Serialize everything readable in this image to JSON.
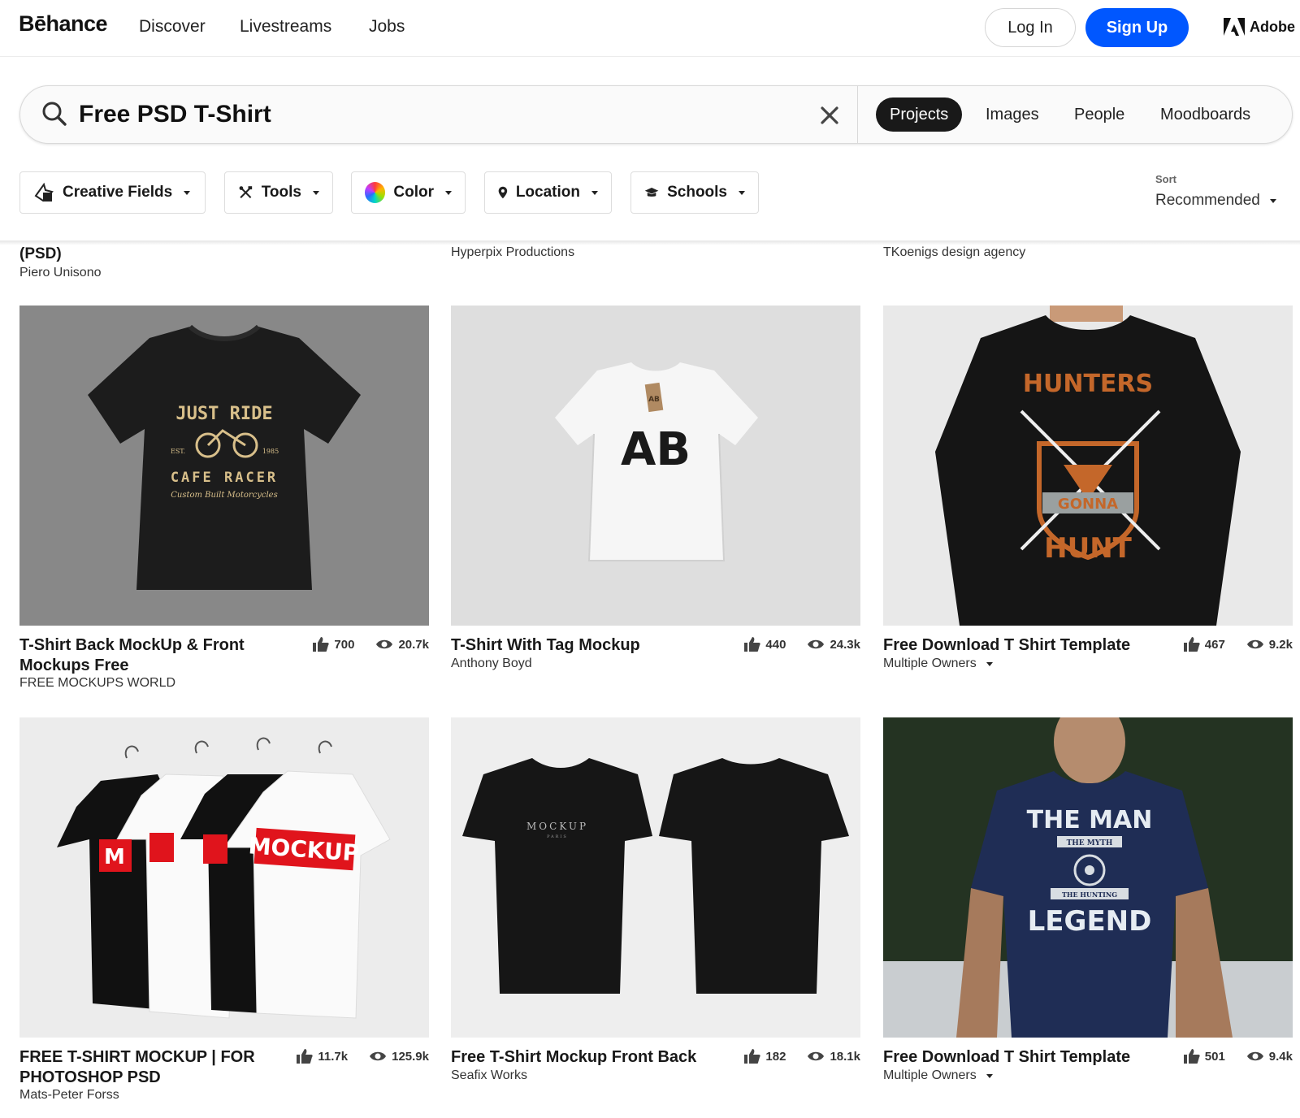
{
  "nav": {
    "logo": "Bēhance",
    "links": [
      "Discover",
      "Livestreams",
      "Jobs"
    ],
    "login": "Log In",
    "signup": "Sign Up",
    "adobe": "Adobe"
  },
  "search": {
    "value": "Free PSD T-Shirt",
    "tabs": [
      "Projects",
      "Images",
      "People",
      "Moodboards"
    ],
    "active_tab": "Projects"
  },
  "filters": {
    "items": [
      "Creative Fields",
      "Tools",
      "Color",
      "Location",
      "Schools"
    ],
    "sort_label": "Sort",
    "sort_value": "Recommended"
  },
  "partial_row": [
    {
      "title": "(PSD)",
      "owner": "Piero Unisono"
    },
    {
      "owner": "Hyperpix Productions"
    },
    {
      "owner": "TKoenigs design agency"
    }
  ],
  "projects": [
    {
      "title": "T-Shirt Back MockUp & Front Mockups Free",
      "owner": "FREE MOCKUPS WORLD",
      "likes": "700",
      "views": "20.7k",
      "shirt_text_1": "JUST RIDE",
      "shirt_text_2": "CAFE RACER",
      "shirt_text_3": "Custom Built Motorcycles",
      "shirt_text_4": "EST.",
      "shirt_text_5": "1985"
    },
    {
      "title": "T-Shirt With Tag Mockup",
      "owner": "Anthony Boyd",
      "likes": "440",
      "views": "24.3k",
      "shirt_text_1": "AB",
      "shirt_text_2": "AB"
    },
    {
      "title": "Free Download T Shirt Template",
      "owner": "Multiple Owners",
      "likes": "467",
      "views": "9.2k",
      "shirt_text_1": "HUNTERS",
      "shirt_text_2": "GONNA",
      "shirt_text_3": "HUNT"
    },
    {
      "title": "FREE T-SHIRT MOCKUP | FOR PHOTOSHOP PSD",
      "owner": "Mats-Peter Forss",
      "likes": "11.7k",
      "views": "125.9k",
      "shirt_text_1": "MOCKUP",
      "shirt_text_2": "M"
    },
    {
      "title": "Free T-Shirt Mockup Front Back",
      "owner": "Seafix Works",
      "likes": "182",
      "views": "18.1k",
      "shirt_text_1": "MOCKUP",
      "shirt_text_2": "PARIS"
    },
    {
      "title": "Free Download T Shirt Template",
      "owner": "Multiple Owners",
      "likes": "501",
      "views": "9.4k",
      "shirt_text_1": "THE MAN",
      "shirt_text_2": "THE MYTH",
      "shirt_text_3": "THE HUNTING",
      "shirt_text_4": "LEGEND"
    }
  ],
  "colors": {
    "brand_blue": "#0057ff",
    "active_tab": "#191919"
  }
}
